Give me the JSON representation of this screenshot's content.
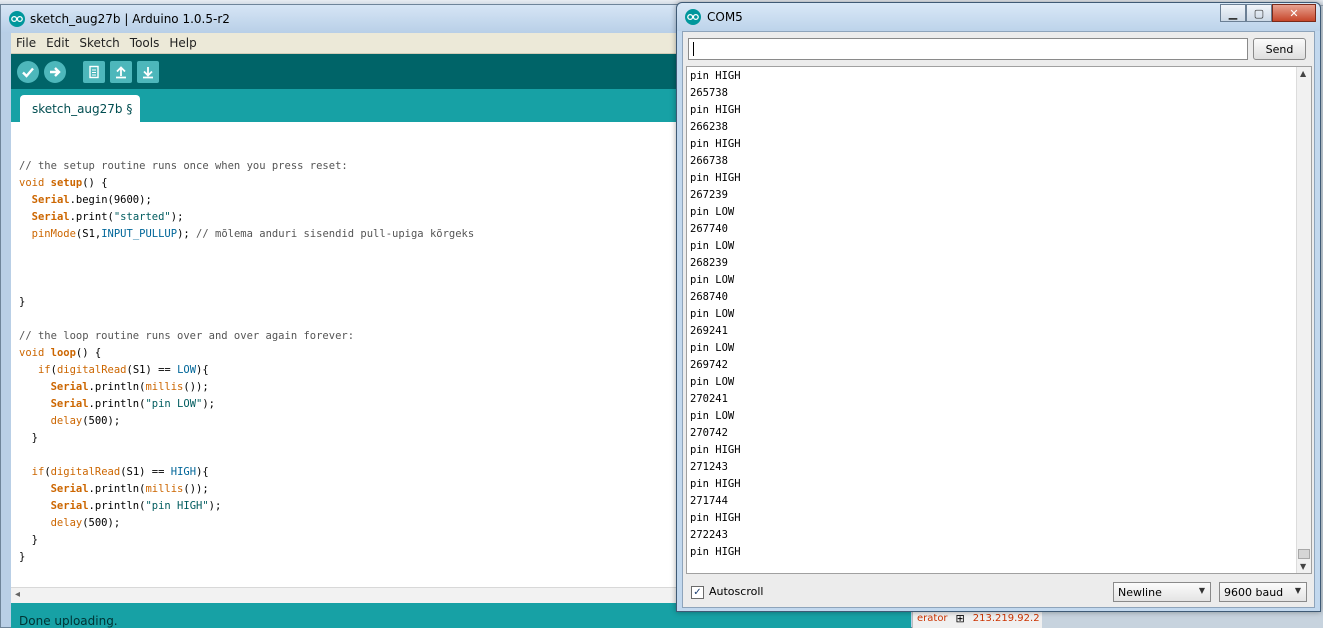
{
  "ide": {
    "title": "sketch_aug27b | Arduino 1.0.5-r2",
    "menus": [
      "File",
      "Edit",
      "Sketch",
      "Tools",
      "Help"
    ],
    "tab_label": "sketch_aug27b §",
    "status": "Done uploading.",
    "code": {
      "c1": "// the setup routine runs once when you press reset:",
      "void1": "void",
      "setup": "setup",
      "setup_rest": "() {",
      "serial1": "Serial",
      "begin": ".begin(9600);",
      "serial2": "Serial",
      "print": ".print(",
      "started": "\"started\"",
      "print_end": ");",
      "pinmode": "pinMode",
      "pinmode_args": "(S1,",
      "input_pullup": "INPUT_PULLUP",
      "pinmode_end": "); ",
      "c2": "// mõlema anduri sisendid pull-upiga kõrgeks",
      "close1": "}",
      "c3": "// the loop routine runs over and over again forever:",
      "void2": "void",
      "loop": "loop",
      "loop_rest": "() {",
      "if1": "if",
      "dr1": "digitalRead",
      "dr1_args": "(S1) == ",
      "low": "LOW",
      "if1_end": "){",
      "serial3": "Serial",
      "println1": ".println(",
      "millis1": "millis",
      "millis1_end": "());",
      "serial4": "Serial",
      "println2": ".println(",
      "pinlow": "\"pin LOW\"",
      "println2_end": ");",
      "delay1": "delay",
      "delay1_args": "(500);",
      "close_if1": "}",
      "if2": "if",
      "dr2": "digitalRead",
      "dr2_args": "(S1) == ",
      "high": "HIGH",
      "if2_end": "){",
      "serial5": "Serial",
      "println3": ".println(",
      "millis2": "millis",
      "millis2_end": "());",
      "serial6": "Serial",
      "println4": ".println(",
      "pinhigh": "\"pin HIGH\"",
      "println4_end": ");",
      "delay2": "delay",
      "delay2_args": "(500);",
      "close_if2": "}",
      "close2": "}"
    }
  },
  "serial_monitor": {
    "title": "COM5",
    "input_value": "",
    "send_label": "Send",
    "output_lines": [
      "pin HIGH",
      "265738",
      "pin HIGH",
      "266238",
      "pin HIGH",
      "266738",
      "pin HIGH",
      "267239",
      "pin LOW",
      "267740",
      "pin LOW",
      "268239",
      "pin LOW",
      "268740",
      "pin LOW",
      "269241",
      "pin LOW",
      "269742",
      "pin LOW",
      "270241",
      "pin LOW",
      "270742",
      "pin HIGH",
      "271243",
      "pin HIGH",
      "271744",
      "pin HIGH",
      "272243",
      "pin HIGH"
    ],
    "autoscroll_label": "Autoscroll",
    "autoscroll_checked": true,
    "line_ending": "Newline",
    "baud": "9600 baud"
  },
  "background": {
    "text1": "erator",
    "text2": "213.219.92.2"
  },
  "colors": {
    "arduino_teal_dark": "#006468",
    "arduino_teal": "#17a1a5",
    "keyword_orange": "#cc6600",
    "constant_blue": "#006699"
  }
}
